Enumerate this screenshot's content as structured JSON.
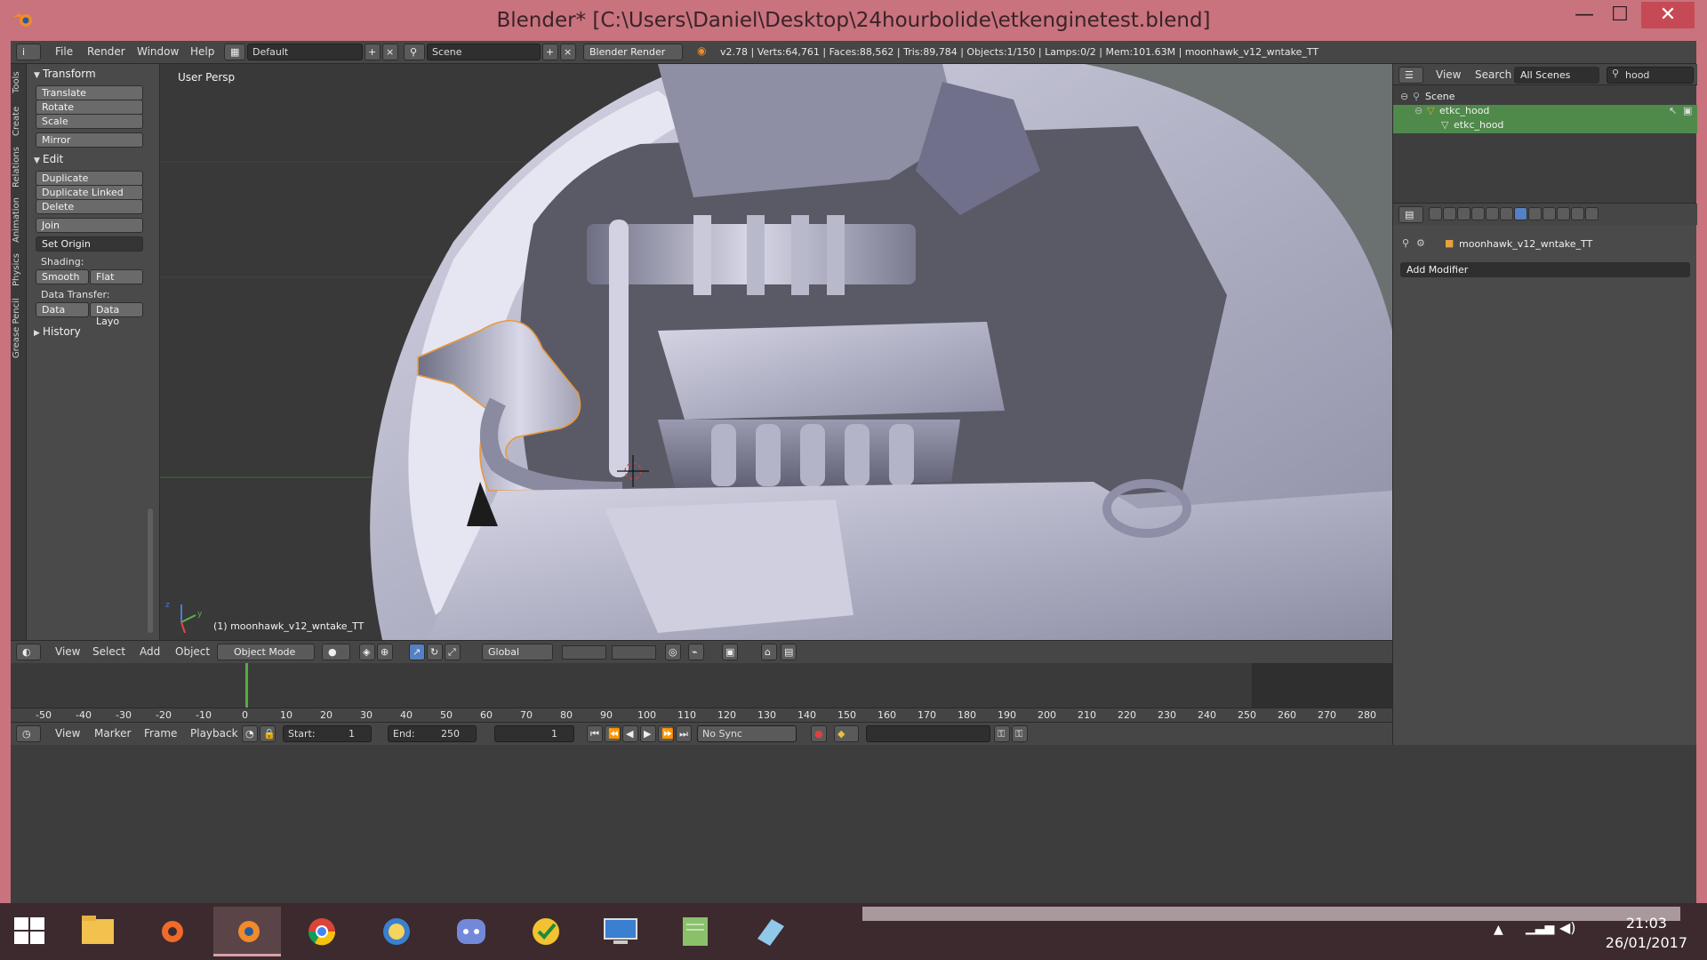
{
  "window": {
    "title": "Blender* [C:\\Users\\Daniel\\Desktop\\24hourbolide\\etkenginetest.blend]",
    "minimize": "—",
    "maximize": "☐",
    "close": "✕"
  },
  "info_header": {
    "menus": [
      "File",
      "Render",
      "Window",
      "Help"
    ],
    "layout": "Default",
    "scene": "Scene",
    "engine": "Blender Render",
    "stats": "v2.78 | Verts:64,761 | Faces:88,562 | Tris:89,784 | Objects:1/150 | Lamps:0/2 | Mem:101.63M | moonhawk_v12_wntake_TT"
  },
  "tool_tabs": [
    "Tools",
    "Create",
    "Relations",
    "Animation",
    "Physics",
    "Grease Pencil"
  ],
  "tool_shelf": {
    "transform": {
      "title": "Transform",
      "buttons": [
        "Translate",
        "Rotate",
        "Scale",
        "Mirror"
      ]
    },
    "edit": {
      "title": "Edit",
      "buttons": [
        "Duplicate",
        "Duplicate Linked",
        "Delete",
        "Join"
      ],
      "set_origin": "Set Origin",
      "shading_label": "Shading:",
      "smooth": "Smooth",
      "flat": "Flat",
      "data_transfer_label": "Data Transfer:",
      "data": "Data",
      "data_layo": "Data Layo"
    },
    "history": {
      "title": "History"
    }
  },
  "viewport": {
    "perspective": "User Persp",
    "object_label": "(1) moonhawk_v12_wntake_TT",
    "axis_y": "y",
    "axis_z": "z"
  },
  "viewport_header": {
    "menus": [
      "View",
      "Select",
      "Add",
      "Object"
    ],
    "mode": "Object Mode",
    "orientation": "Global"
  },
  "timeline": {
    "ticks": [
      "-50",
      "-40",
      "-30",
      "-20",
      "-10",
      "0",
      "10",
      "20",
      "30",
      "40",
      "50",
      "60",
      "70",
      "80",
      "90",
      "100",
      "110",
      "120",
      "130",
      "140",
      "150",
      "160",
      "170",
      "180",
      "190",
      "200",
      "210",
      "220",
      "230",
      "240",
      "250",
      "260",
      "270",
      "280"
    ],
    "current_frame": 1,
    "menus": [
      "View",
      "Marker",
      "Frame",
      "Playback"
    ],
    "start_label": "Start:",
    "start": "1",
    "end_label": "End:",
    "end": "250",
    "frame": "1",
    "sync": "No Sync"
  },
  "outliner": {
    "menus": [
      "View",
      "Search"
    ],
    "scope": "All Scenes",
    "search": "hood",
    "rows": [
      {
        "label": "Scene",
        "indent": 0,
        "selected": false
      },
      {
        "label": "etkc_hood",
        "indent": 1,
        "selected": true
      },
      {
        "label": "etkc_hood",
        "indent": 2,
        "selected": true
      }
    ]
  },
  "properties": {
    "object_name": "moonhawk_v12_wntake_TT",
    "add_modifier": "Add Modifier"
  },
  "taskbar": {
    "apps": [
      "start-icon",
      "file-explorer-icon",
      "origin-icon",
      "blender-icon",
      "chrome-icon",
      "fallout-icon",
      "discord-icon",
      "norton-icon",
      "remote-desktop-icon",
      "notepad-icon",
      "eraser-icon"
    ],
    "time": "21:03",
    "date": "26/01/2017"
  },
  "colors": {
    "window_frame": "#c8737e",
    "selection_green": "#4f8a4a",
    "active_blue": "#5680c2",
    "taskbar": "#3c2a2e"
  }
}
